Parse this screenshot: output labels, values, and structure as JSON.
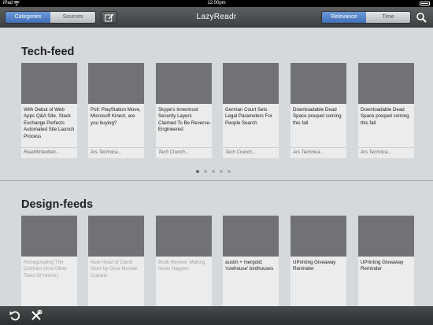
{
  "status_bar": {
    "carrier": "iPad",
    "time": "12:00pm"
  },
  "toolbar": {
    "left_segments": [
      {
        "label": "Categories",
        "active": true
      },
      {
        "label": "Sources",
        "active": false
      }
    ],
    "app_title": "LazyReadr",
    "right_segments": [
      {
        "label": "Relevance",
        "active": true
      },
      {
        "label": "Time",
        "active": false
      }
    ]
  },
  "sections": [
    {
      "title": "Tech-feed",
      "cards": [
        {
          "headline": "With Debut of Web Apps Q&A Site, Stack Exchange Perfects Automated Site Launch Process",
          "source": "ReadWriteWeb...",
          "dim": false
        },
        {
          "headline": "Poll: PlayStation Move, Microsoft Kinect, are you buying?",
          "source": "Ars Technica...",
          "dim": false
        },
        {
          "headline": "Skype's Innermost Security Layers Claimed To Be Reverse-Engineered",
          "source": "Tech Crunch...",
          "dim": false
        },
        {
          "headline": "German Court Sets Legal Parameters For People Search",
          "source": "Tech Crunch...",
          "dim": false
        },
        {
          "headline": "Downloadable Dead Space prequel coming this fall",
          "source": "Ars Technica...",
          "dim": false
        },
        {
          "headline": "Downloadable Dead Space prequel coming this fall",
          "source": "Ars Technica...",
          "dim": false
        }
      ],
      "page_count": 5,
      "current_page": 1
    },
    {
      "title": "Design-feeds",
      "cards": [
        {
          "headline": "Renegotiating The Contract (And Other Tales Of Horror)",
          "dim": true
        },
        {
          "headline": "New Head of David Stool by Onur Mustak Cobanli",
          "dim": true
        },
        {
          "headline": "Book Review: Making Ideas Happen",
          "dim": true
        },
        {
          "headline": "austin + mergold: 'rowhouse' birdhouses",
          "dim": false
        },
        {
          "headline": "UPrinting Giveaway Reminder",
          "dim": false
        },
        {
          "headline": "UPrinting Giveaway Reminder",
          "dim": false
        }
      ]
    }
  ],
  "icons": {
    "compose": "compose-icon",
    "search": "search-icon",
    "refresh": "refresh-icon",
    "settings": "tools-icon"
  }
}
